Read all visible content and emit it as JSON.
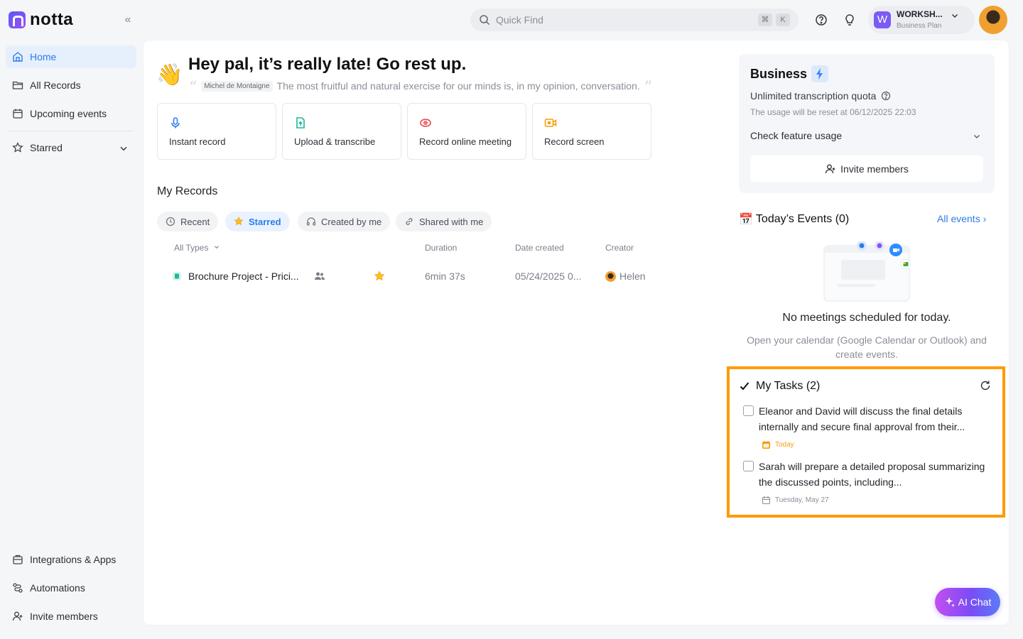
{
  "app": {
    "logo_text": "notta"
  },
  "sidebar": {
    "items": [
      {
        "label": "Home"
      },
      {
        "label": "All Records"
      },
      {
        "label": "Upcoming events"
      },
      {
        "label": "Starred"
      }
    ],
    "bottom_items": [
      {
        "label": "Integrations & Apps"
      },
      {
        "label": "Automations"
      },
      {
        "label": "Invite members"
      }
    ]
  },
  "topbar": {
    "search_placeholder": "Quick Find",
    "shortcut_keys": [
      "⌘",
      "K"
    ],
    "workspace_initial": "W",
    "workspace_name": "WORKSH...",
    "workspace_plan": "Business Plan"
  },
  "greeting": {
    "emoji": "👋",
    "title": "Hey pal, it’s really late! Go rest up.",
    "quote_author": "Michel de Montaigne",
    "quote_text": "The most fruitful and natural exercise for our minds is, in my opinion, conversation."
  },
  "actions": [
    {
      "label": "Instant record",
      "icon": "mic-icon",
      "color": "#2b7de9"
    },
    {
      "label": "Upload & transcribe",
      "icon": "upload-icon",
      "color": "#1fb89a"
    },
    {
      "label": "Record online meeting",
      "icon": "meeting-icon",
      "color": "#e5484d"
    },
    {
      "label": "Record screen",
      "icon": "screen-record-icon",
      "color": "#f59e0b"
    }
  ],
  "records": {
    "title": "My Records",
    "tabs": [
      {
        "label": "Recent"
      },
      {
        "label": "Starred"
      },
      {
        "label": "Created by me"
      },
      {
        "label": "Shared with me"
      }
    ],
    "active_tab": "Starred",
    "columns": {
      "type": "All Types",
      "duration": "Duration",
      "date": "Date created",
      "creator": "Creator"
    },
    "rows": [
      {
        "name": "Brochure Project - Prici...",
        "duration": "6min 37s",
        "date": "05/24/2025 0...",
        "creator": "Helen"
      }
    ]
  },
  "business": {
    "title": "Business",
    "quota": "Unlimited transcription quota",
    "reset": "The usage will be reset at 06/12/2025 22:03",
    "check_usage": "Check feature usage",
    "invite": "Invite members"
  },
  "events": {
    "calendar_emoji": "📅",
    "title": "Today’s Events (0)",
    "all_events": "All events",
    "empty_title": "No meetings scheduled for today.",
    "empty_sub": "Open your calendar (Google Calendar or Outlook) and create events."
  },
  "tasks": {
    "title": "My Tasks (2)",
    "items": [
      {
        "text": "Eleanor and David will discuss the final details internally and secure final approval from their...",
        "due": "Today",
        "due_color": "#f59e0b"
      },
      {
        "text": "Sarah will prepare a detailed proposal summarizing the discussed points, including...",
        "due": "Tuesday, May 27",
        "due_color": "#8a8f98"
      }
    ]
  },
  "ai_chat": {
    "label": "AI Chat"
  },
  "colors": {
    "accent": "#2b7de9",
    "highlight": "#ff9a00"
  }
}
